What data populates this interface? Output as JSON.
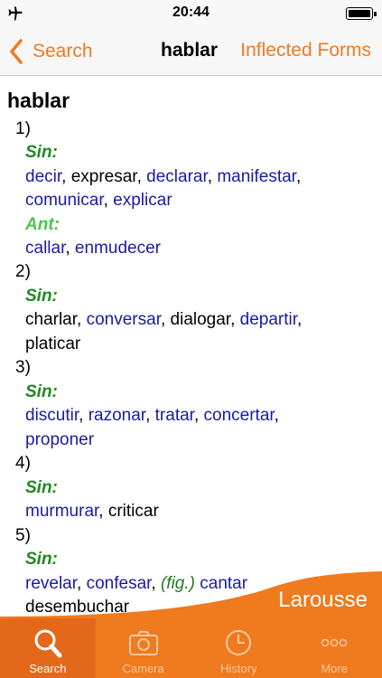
{
  "status_bar": {
    "time": "20:44"
  },
  "nav": {
    "back_label": "Search",
    "title": "hablar",
    "inflected_label": "Inflected Forms"
  },
  "entry": {
    "headword": "hablar",
    "senses": [
      {
        "number": "1)",
        "syn_label": "Sin:",
        "syn_line1": [
          "decir",
          "expresar",
          "declarar",
          "manifestar"
        ],
        "syn_line2": [
          "comunicar",
          "explicar"
        ],
        "ant_label": "Ant:",
        "ant_line": [
          "callar",
          "enmudecer"
        ]
      },
      {
        "number": "2)",
        "syn_label": "Sin:",
        "syn_line1": [
          "charlar",
          "conversar",
          "dialogar",
          "departir"
        ],
        "syn_line2": [
          "platicar"
        ]
      },
      {
        "number": "3)",
        "syn_label": "Sin:",
        "syn_line1": [
          "discutir",
          "razonar",
          "tratar",
          "concertar"
        ],
        "syn_line2": [
          "proponer"
        ]
      },
      {
        "number": "4)",
        "syn_label": "Sin:",
        "syn_line1": [
          "murmurar",
          "criticar"
        ]
      },
      {
        "number": "5)",
        "syn_label": "Sin:",
        "syn_line1": [
          "revelar",
          "confesar",
          "(fig.)",
          "cantar"
        ],
        "syn_line2": [
          "desembuchar"
        ]
      }
    ]
  },
  "brand": "Larousse",
  "tabs": [
    {
      "label": "Search",
      "icon": "search-icon",
      "active": true
    },
    {
      "label": "Camera",
      "icon": "camera-icon",
      "active": false
    },
    {
      "label": "History",
      "icon": "clock-icon",
      "active": false
    },
    {
      "label": "More",
      "icon": "more-dots-icon",
      "active": false
    }
  ],
  "colors": {
    "accent": "#f07a1e",
    "link": "#1a1aa8",
    "synonym_label": "#1f8a1f",
    "antonym_label": "#4cc44c"
  }
}
